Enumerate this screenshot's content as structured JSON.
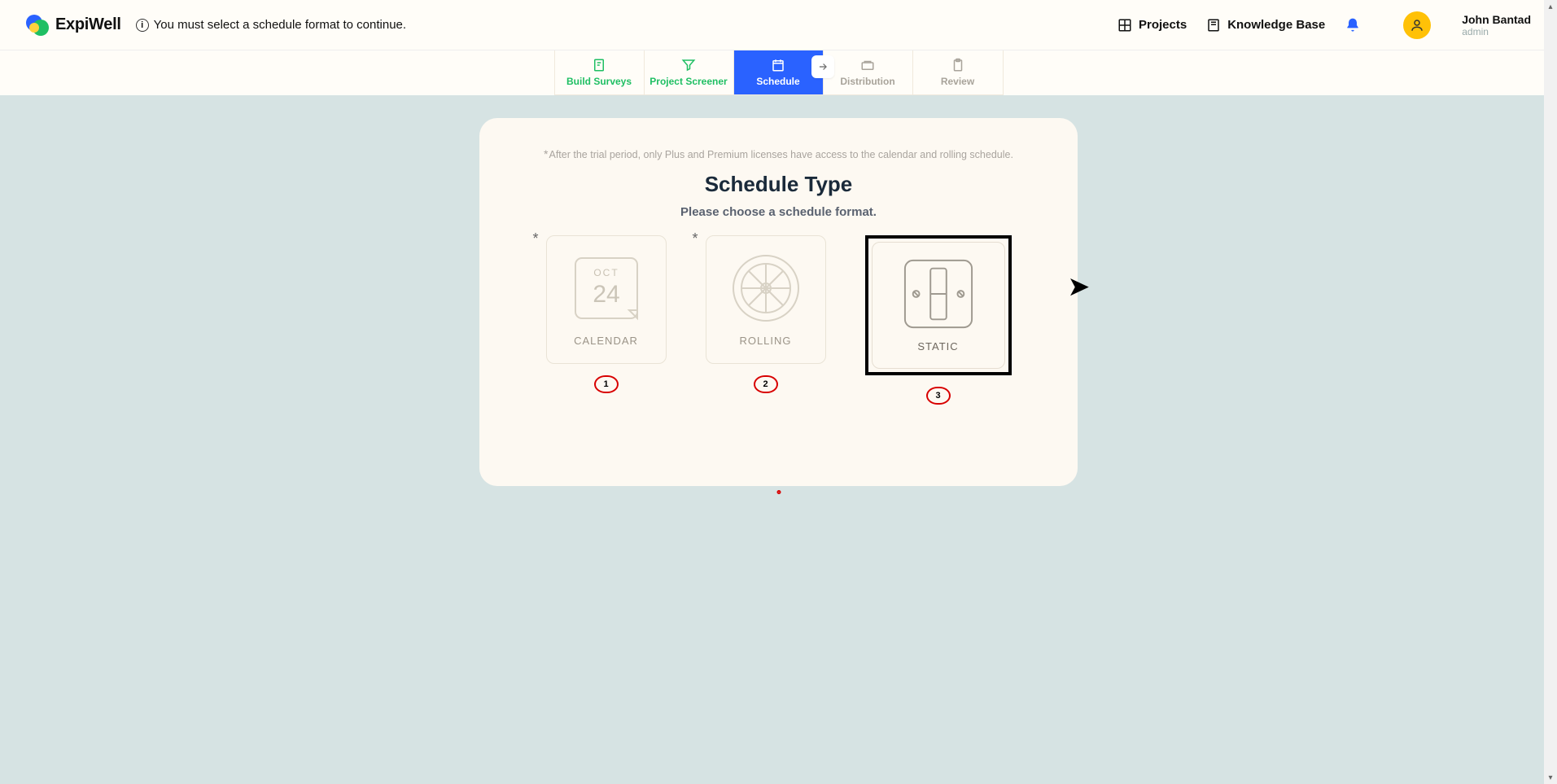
{
  "brand": {
    "name": "ExpiWell"
  },
  "notice": {
    "text": "You must select a schedule format to continue."
  },
  "nav": {
    "projects": "Projects",
    "kb": "Knowledge Base"
  },
  "user": {
    "name": "John Bantad",
    "role": "admin"
  },
  "tabs": {
    "build": "Build Surveys",
    "screener": "Project Screener",
    "schedule": "Schedule",
    "distribution": "Distribution",
    "review": "Review"
  },
  "card": {
    "disclaimer": "After the trial period, only Plus and Premium licenses have access to the calendar and rolling schedule.",
    "title": "Schedule Type",
    "subtitle": "Please choose a schedule format."
  },
  "options": {
    "calendar": {
      "label": "CALENDAR",
      "month": "OCT",
      "day": "24"
    },
    "rolling": {
      "label": "ROLLING"
    },
    "static": {
      "label": "STATIC"
    }
  },
  "markers": {
    "m1": "1",
    "m2": "2",
    "m3": "3"
  }
}
